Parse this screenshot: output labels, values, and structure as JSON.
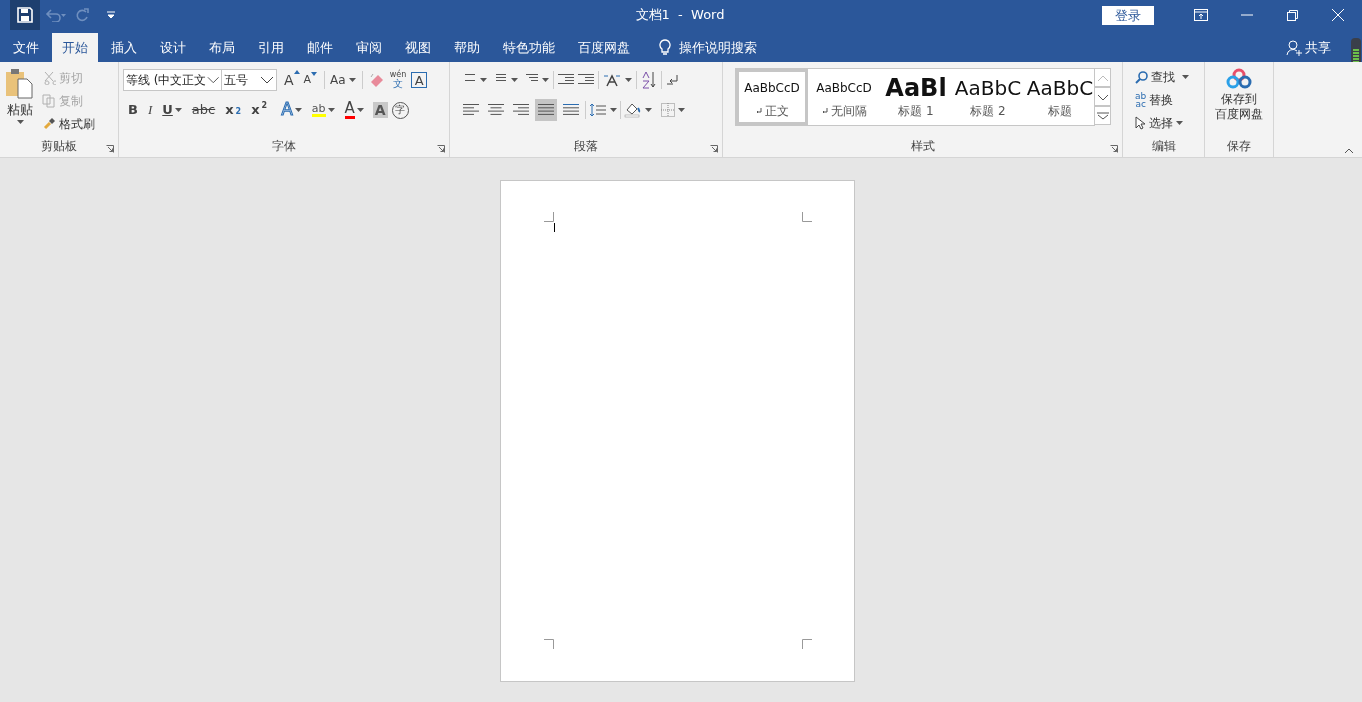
{
  "title_bar": {
    "title": "文档1  -  Word",
    "login": "登录"
  },
  "tabs": [
    {
      "label": "文件",
      "selected": false
    },
    {
      "label": "开始",
      "selected": true
    },
    {
      "label": "插入",
      "selected": false
    },
    {
      "label": "设计",
      "selected": false
    },
    {
      "label": "布局",
      "selected": false
    },
    {
      "label": "引用",
      "selected": false
    },
    {
      "label": "邮件",
      "selected": false
    },
    {
      "label": "审阅",
      "selected": false
    },
    {
      "label": "视图",
      "selected": false
    },
    {
      "label": "帮助",
      "selected": false
    },
    {
      "label": "特色功能",
      "selected": false
    },
    {
      "label": "百度网盘",
      "selected": false
    }
  ],
  "tell_me": "操作说明搜索",
  "share": "共享",
  "clipboard": {
    "label": "剪贴板",
    "paste": "粘贴",
    "cut": {
      "label": "剪切",
      "disabled": true
    },
    "copy": {
      "label": "复制",
      "disabled": true
    },
    "format_painter": {
      "label": "格式刷",
      "disabled": false
    }
  },
  "font": {
    "label": "字体",
    "font_name": "等线 (中文正文",
    "font_size": "五号",
    "grow": "A",
    "shrink": "A",
    "change_case": "Aa",
    "phonetic_top": "wén",
    "phonetic_bottom": "文",
    "char_border": "A",
    "row2": [
      {
        "kind": "bold",
        "text": "B"
      },
      {
        "kind": "italic",
        "text": "I"
      },
      {
        "kind": "underline",
        "text": "U"
      },
      {
        "kind": "strike",
        "text": "abc"
      },
      {
        "kind": "sub",
        "text": "x",
        "small": "2"
      },
      {
        "kind": "sup",
        "text": "x",
        "small": "2"
      },
      {
        "kind": "effect",
        "text": "A"
      },
      {
        "kind": "highlight",
        "text": "ab"
      },
      {
        "kind": "color",
        "text": "A"
      },
      {
        "kind": "shade",
        "text": "A"
      },
      {
        "kind": "enclose",
        "text": "字"
      }
    ]
  },
  "paragraph": {
    "label": "段落",
    "alignment": [
      {
        "selected": false
      },
      {
        "selected": false
      },
      {
        "selected": false
      },
      {
        "selected": true
      },
      {
        "selected": false
      }
    ]
  },
  "styles": {
    "label": "样式",
    "items": [
      {
        "preview": "AaBbCcD",
        "name": "正文",
        "kind": "body",
        "selected": true
      },
      {
        "preview": "AaBbCcD",
        "name": "无间隔",
        "kind": "body",
        "selected": false
      },
      {
        "preview": "AaBl",
        "name": "标题 1",
        "kind": "h1",
        "selected": false
      },
      {
        "preview": "AaBbC",
        "name": "标题 2",
        "kind": "h2",
        "selected": false
      },
      {
        "preview": "AaBbC",
        "name": "标题",
        "kind": "title",
        "selected": false
      }
    ]
  },
  "editing": {
    "label": "编辑",
    "find": "查找",
    "replace": "替换",
    "replace_icon_top": "ab",
    "replace_icon_bottom": "ac",
    "select": "选择"
  },
  "save_group": {
    "label": "保存",
    "button_lines": [
      "保存到",
      "百度网盘"
    ]
  }
}
